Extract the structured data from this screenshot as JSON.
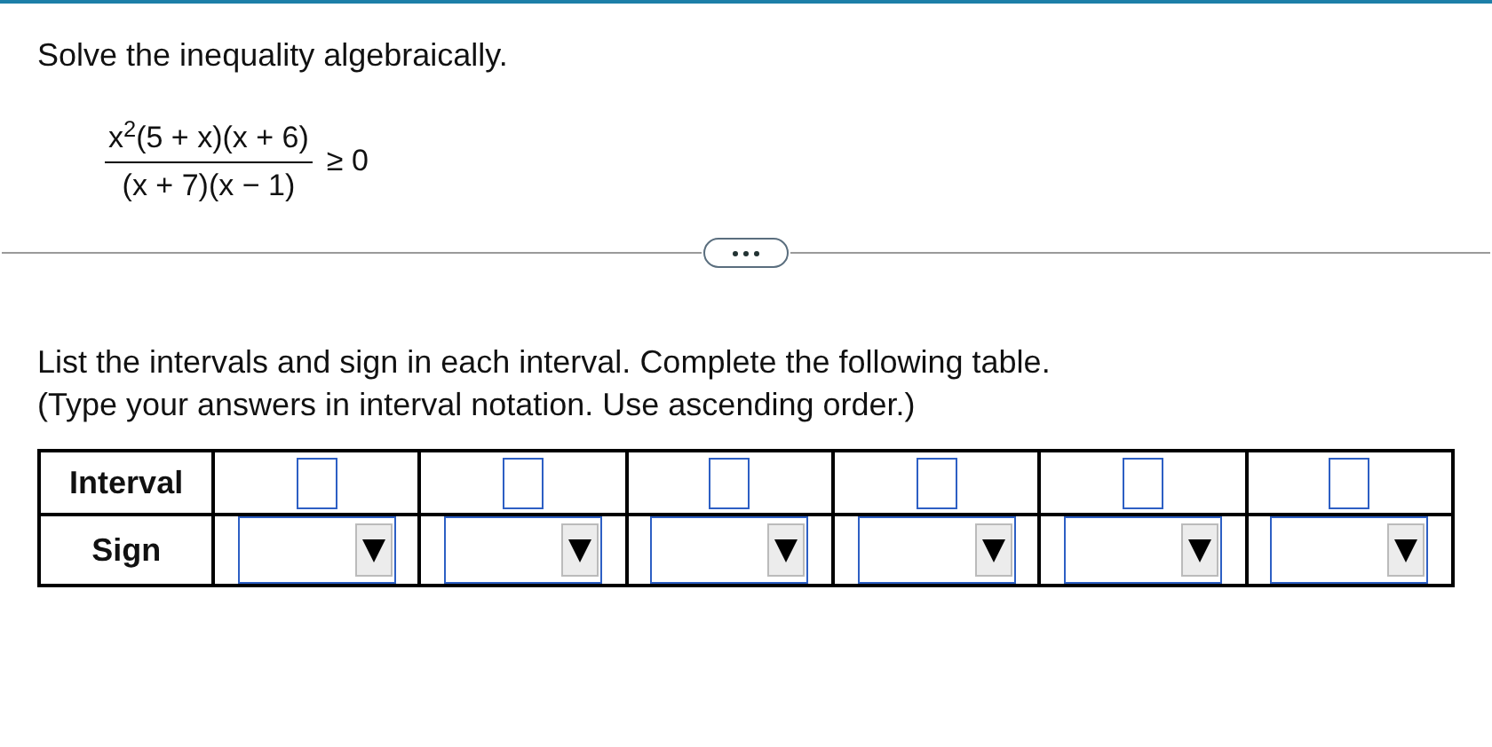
{
  "question": "Solve the inequality algebraically.",
  "expression": {
    "numerator": "x$^{2}$(5 + x)(x + 6)",
    "denominator": "(x + 7)(x − 1)",
    "relation": "≥ 0"
  },
  "instructions": [
    "List the intervals and sign in each interval. Complete the following table.",
    "(Type your answers in interval notation. Use ascending order.)"
  ],
  "table": {
    "rows": [
      {
        "header": "Interval",
        "cells": [
          {
            "kind": "text"
          },
          {
            "kind": "text"
          },
          {
            "kind": "text"
          },
          {
            "kind": "text"
          },
          {
            "kind": "text"
          },
          {
            "kind": "text"
          }
        ]
      },
      {
        "header": "Sign",
        "cells": [
          {
            "kind": "dropdown"
          },
          {
            "kind": "dropdown"
          },
          {
            "kind": "dropdown"
          },
          {
            "kind": "dropdown"
          },
          {
            "kind": "dropdown"
          },
          {
            "kind": "dropdown"
          }
        ]
      }
    ]
  }
}
